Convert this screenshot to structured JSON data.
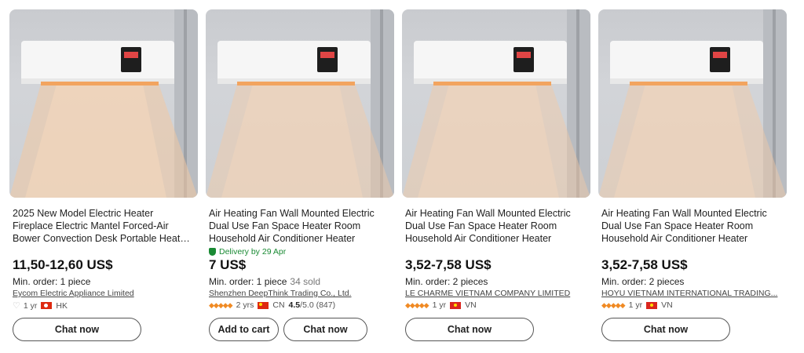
{
  "products": [
    {
      "title": "2025 New Model Electric Heater Fireplace Electric Mantel Forced-Air Bower Convection Desk Portable Heater Fan...",
      "delivery": "",
      "price": "11,50-12,60 US$",
      "min_order": "Min. order: 1 piece",
      "sold": "",
      "supplier": "Eycom Electric Appliance Limited",
      "years": "1 yr",
      "country": "HK",
      "rating": "",
      "rating_suffix": "",
      "buttons": [
        "Chat now"
      ]
    },
    {
      "title": "Air Heating Fan Wall Mounted Electric Dual Use Fan Space Heater Room Household Air Conditioner Heater",
      "delivery": "Delivery by 29 Apr",
      "price": "7 US$",
      "min_order": "Min. order: 1 piece",
      "sold": "34 sold",
      "supplier": "Shenzhen DeepThink Trading Co., Ltd.",
      "years": "2 yrs",
      "country": "CN",
      "rating": "4.5",
      "rating_suffix": "/5.0 (847)",
      "buttons": [
        "Add to cart",
        "Chat now"
      ]
    },
    {
      "title": "Air Heating Fan Wall Mounted Electric Dual Use Fan Space Heater Room Household Air Conditioner Heater",
      "delivery": "",
      "price": "3,52-7,58 US$",
      "min_order": "Min. order: 2 pieces",
      "sold": "",
      "supplier": "LE CHARME VIETNAM COMPANY LIMITED",
      "years": "1 yr",
      "country": "VN",
      "rating": "",
      "rating_suffix": "",
      "buttons": [
        "Chat now"
      ]
    },
    {
      "title": "Air Heating Fan Wall Mounted Electric Dual Use Fan Space Heater Room Household Air Conditioner Heater",
      "delivery": "",
      "price": "3,52-7,58 US$",
      "min_order": "Min. order: 2 pieces",
      "sold": "",
      "supplier": "HOYU VIETNAM INTERNATIONAL TRADING...",
      "years": "1 yr",
      "country": "VN",
      "rating": "",
      "rating_suffix": "",
      "buttons": [
        "Chat now"
      ]
    }
  ],
  "icons": {
    "supplier_badge": "diamond-badge-icon",
    "delivery": "shield-check-icon",
    "flag": "country-flag-icon"
  },
  "colors": {
    "delivery_green": "#1a8a34",
    "badge_orange": "#f08a24",
    "heat_glow": "#f0b27a"
  }
}
